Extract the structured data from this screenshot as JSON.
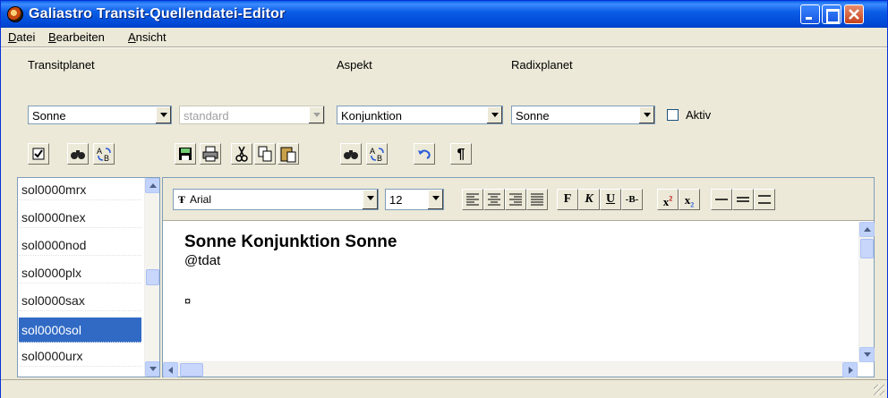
{
  "window": {
    "title": "Galiastro Transit-Quellendatei-Editor"
  },
  "menu": [
    {
      "label": "Datei",
      "accel": "D",
      "rest": "atei"
    },
    {
      "label": "Bearbeiten",
      "accel": "B",
      "rest": "earbeiten"
    },
    {
      "label": "Ansicht",
      "accel": "A",
      "rest": "nsicht"
    }
  ],
  "filters": {
    "transitplanet_label": "Transitplanet",
    "transitplanet_value": "Sonne",
    "variant_value": "standard",
    "aspekt_label": "Aspekt",
    "aspekt_value": "Konjunktion",
    "radixplanet_label": "Radixplanet",
    "radixplanet_value": "Sonne",
    "aktiv_label": "Aktiv"
  },
  "file_list": [
    "sol0000mrx",
    "sol0000nex",
    "sol0000nod",
    "sol0000plx",
    "sol0000sax",
    "sol0000sol",
    "sol0000urx"
  ],
  "selected_file": "sol0000sol",
  "format": {
    "font": "Arial",
    "size": "12",
    "bold_label": "F",
    "italic_label": "K",
    "underline_label": "U",
    "strike_label": "-B-"
  },
  "document": {
    "heading": "Sonne Konjunktion Sonne",
    "line1": "@tdat",
    "marker": "¤"
  },
  "colors": {
    "titlebar": "#0b5ee6",
    "selection": "#316ac5",
    "face": "#ece9d8"
  }
}
